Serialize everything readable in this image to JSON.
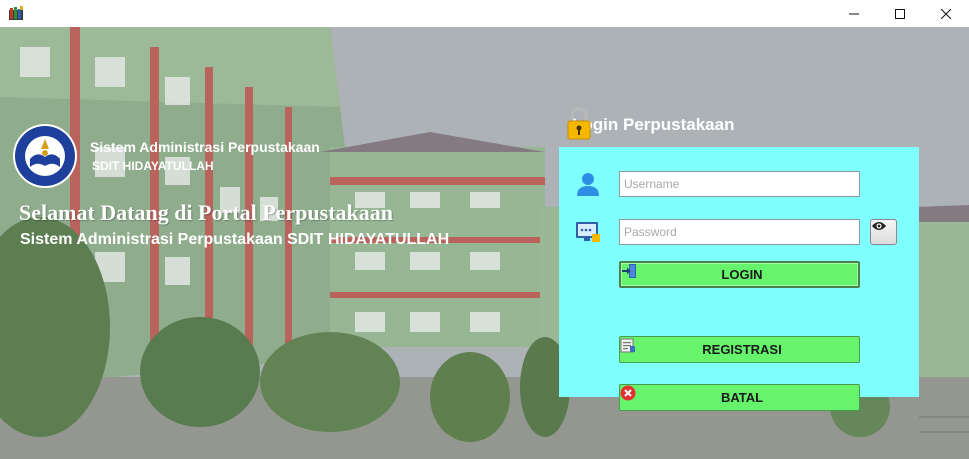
{
  "window": {
    "controls": {
      "minimize": "─",
      "maximize": "☐",
      "close": "✕"
    }
  },
  "branding": {
    "system_title": "Sistem Administrasi Perpustakaan",
    "school_name": "SDIT HIDAYATULLAH",
    "logo_icon": "school-emblem-icon"
  },
  "welcome": {
    "headline": "Selamat Datang di Portal Perpustakaan",
    "subline": "Sistem Administrasi Perpustakaan SDIT HIDAYATULLAH"
  },
  "login": {
    "title": "Login Perpustakaan",
    "username_placeholder": "Username",
    "password_placeholder": "Password",
    "login_label": "LOGIN",
    "register_label": "REGISTRASI",
    "cancel_label": "BATAL"
  },
  "colors": {
    "panel_background": "#80ffff",
    "button_green": "#66f46c"
  }
}
